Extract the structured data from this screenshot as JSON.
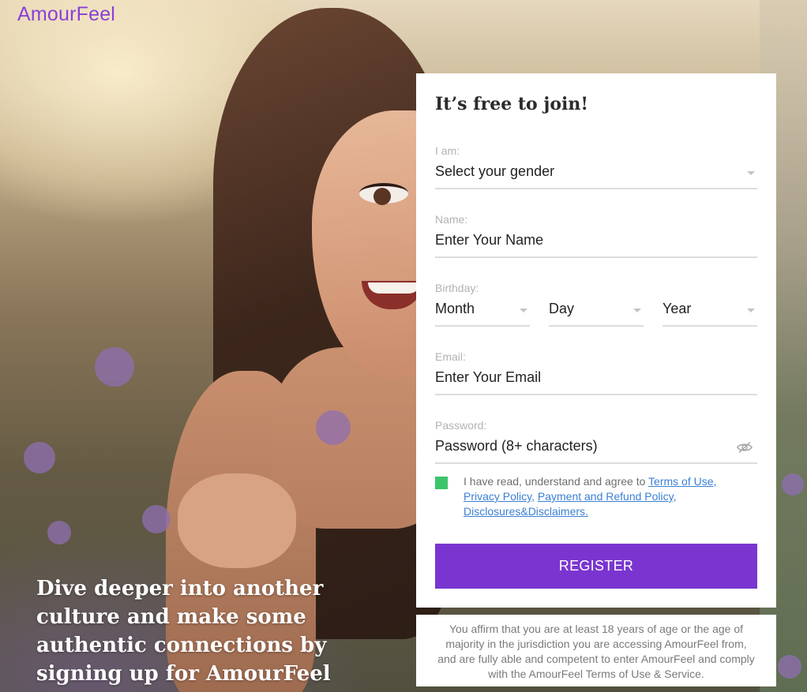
{
  "brand": {
    "logo_text": "AmourFeel",
    "accent_color": "#7a35d0",
    "logo_color": "#8a3fd8"
  },
  "hero": {
    "tagline": "Dive deeper into another culture and make some authentic connections by signing up for AmourFeel"
  },
  "form": {
    "title": "It’s free to join!",
    "gender": {
      "label": "I am:",
      "value": "Select your gender"
    },
    "name": {
      "label": "Name:",
      "placeholder": "Enter Your Name"
    },
    "birthday": {
      "label": "Birthday:",
      "month": "Month",
      "day": "Day",
      "year": "Year"
    },
    "email": {
      "label": "Email:",
      "placeholder": "Enter Your Email"
    },
    "password": {
      "label": "Password:",
      "placeholder": "Password (8+ characters)",
      "toggle_icon": "eye-slash-icon"
    },
    "agree": {
      "checked": true,
      "checkbox_color": "#3cc46b",
      "prefix": "I have read, understand and agree to ",
      "link_terms": "Terms of Use,",
      "link_privacy": "Privacy Policy,",
      "link_payment": "Payment and Refund Policy,",
      "link_disclosures": "Disclosures&Disclaimers."
    },
    "register_label": "REGISTER"
  },
  "disclaimer": {
    "text": "You affirm that you are at least 18 years of age or the age of majority in the jurisdiction you are accessing AmourFeel from, and are fully able and competent to enter AmourFeel and comply with the AmourFeel Terms of Use & Service."
  }
}
